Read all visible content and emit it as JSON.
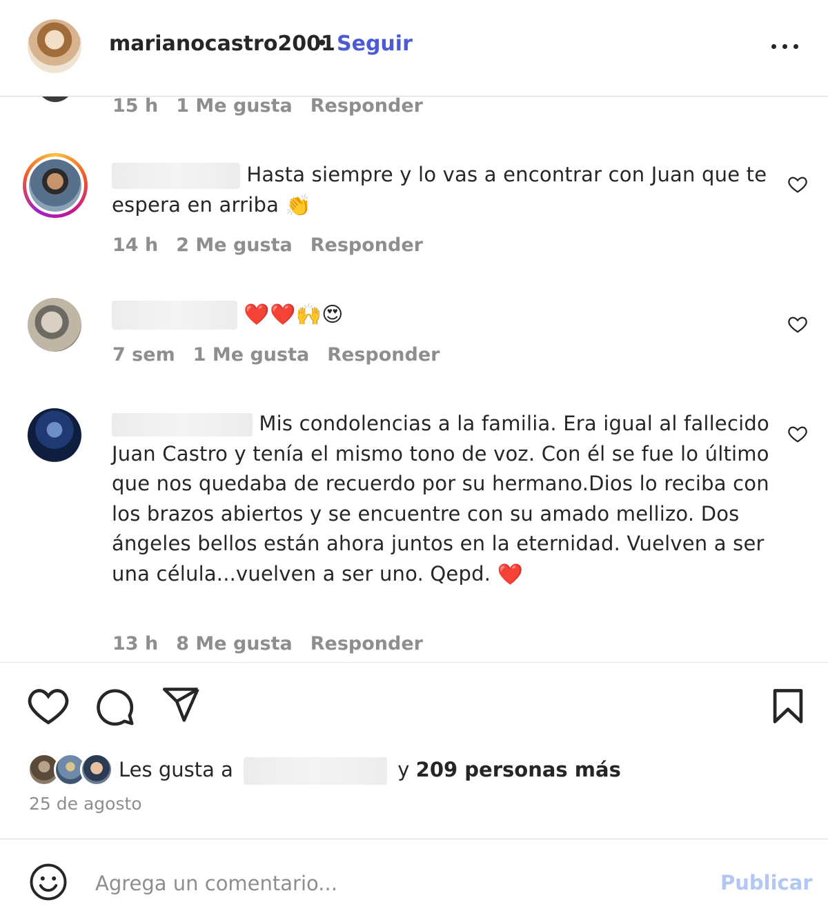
{
  "header": {
    "username": "marianocastro2001",
    "separator": "•",
    "follow_label": "Seguir"
  },
  "comments": [
    {
      "time": "15 h",
      "likes": "1 Me gusta",
      "reply": "Responder"
    },
    {
      "text": "Hasta siempre y lo vas a encontrar con Juan que te espera en arriba",
      "emoji": "👏",
      "time": "14 h",
      "likes": "2 Me gusta",
      "reply": "Responder"
    },
    {
      "emoji": "❤️❤️🙌😍",
      "time": "7 sem",
      "likes": "1 Me gusta",
      "reply": "Responder"
    },
    {
      "text": "Mis condolencias a la familia. Era igual al fallecido Juan Castro y tenía el mismo tono de voz. Con él se fue lo último que nos quedaba de recuerdo por su hermano.Dios lo reciba con los brazos abiertos y se encuentre con su amado mellizo. Dos ángeles bellos están ahora juntos en la eternidad. Vuelven a ser una célula...vuelven a ser uno. Qepd.",
      "emoji": "❤️",
      "time": "13 h",
      "likes": "8 Me gusta",
      "reply": "Responder"
    }
  ],
  "actions": {
    "like_icon": "heart-icon",
    "comment_icon": "speech-bubble-icon",
    "share_icon": "paper-plane-icon",
    "save_icon": "bookmark-icon"
  },
  "likes_summary": {
    "prefix": "Les gusta a",
    "connector": "y",
    "rest": "209 personas más"
  },
  "post_date": "25 de agosto",
  "comment_box": {
    "placeholder": "Agrega un comentario...",
    "publish_label": "Publicar"
  },
  "colors": {
    "follow": "#4a5bd4",
    "publish_disabled": "#b3c7f5",
    "meta_gray": "#8e8e8e"
  }
}
